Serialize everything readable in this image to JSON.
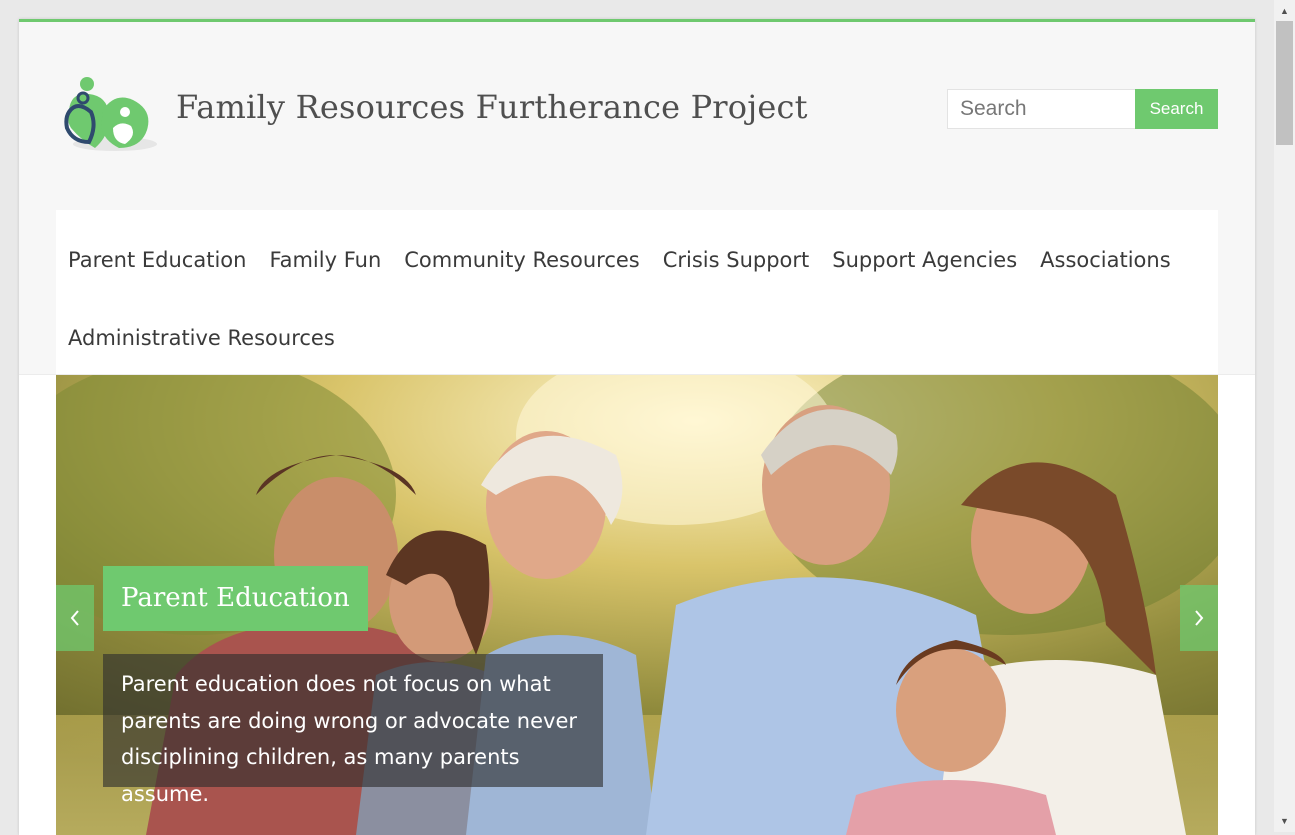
{
  "colors": {
    "accent": "#6fc96f",
    "logo_green": "#6fc96f",
    "logo_navy": "#2f4a6e",
    "text": "#3a3a3a"
  },
  "header": {
    "logo_icon": "family-hearts-logo",
    "site_title": "Family  Resources Furtherance Project",
    "search": {
      "placeholder": "Search",
      "value": "",
      "button_label": "Search"
    }
  },
  "nav": {
    "items": [
      {
        "label": "Parent Education"
      },
      {
        "label": "Family Fun"
      },
      {
        "label": "Community Resources"
      },
      {
        "label": "Crisis Support"
      },
      {
        "label": "Support Agencies"
      },
      {
        "label": "Associations"
      },
      {
        "label": "Administrative Resources"
      }
    ]
  },
  "slider": {
    "title": "Parent Education",
    "description": "Parent education does not focus on what parents are doing wrong or advocate never disciplining children, as many parents assume.",
    "prev_icon": "chevron-left-icon",
    "next_icon": "chevron-right-icon"
  }
}
